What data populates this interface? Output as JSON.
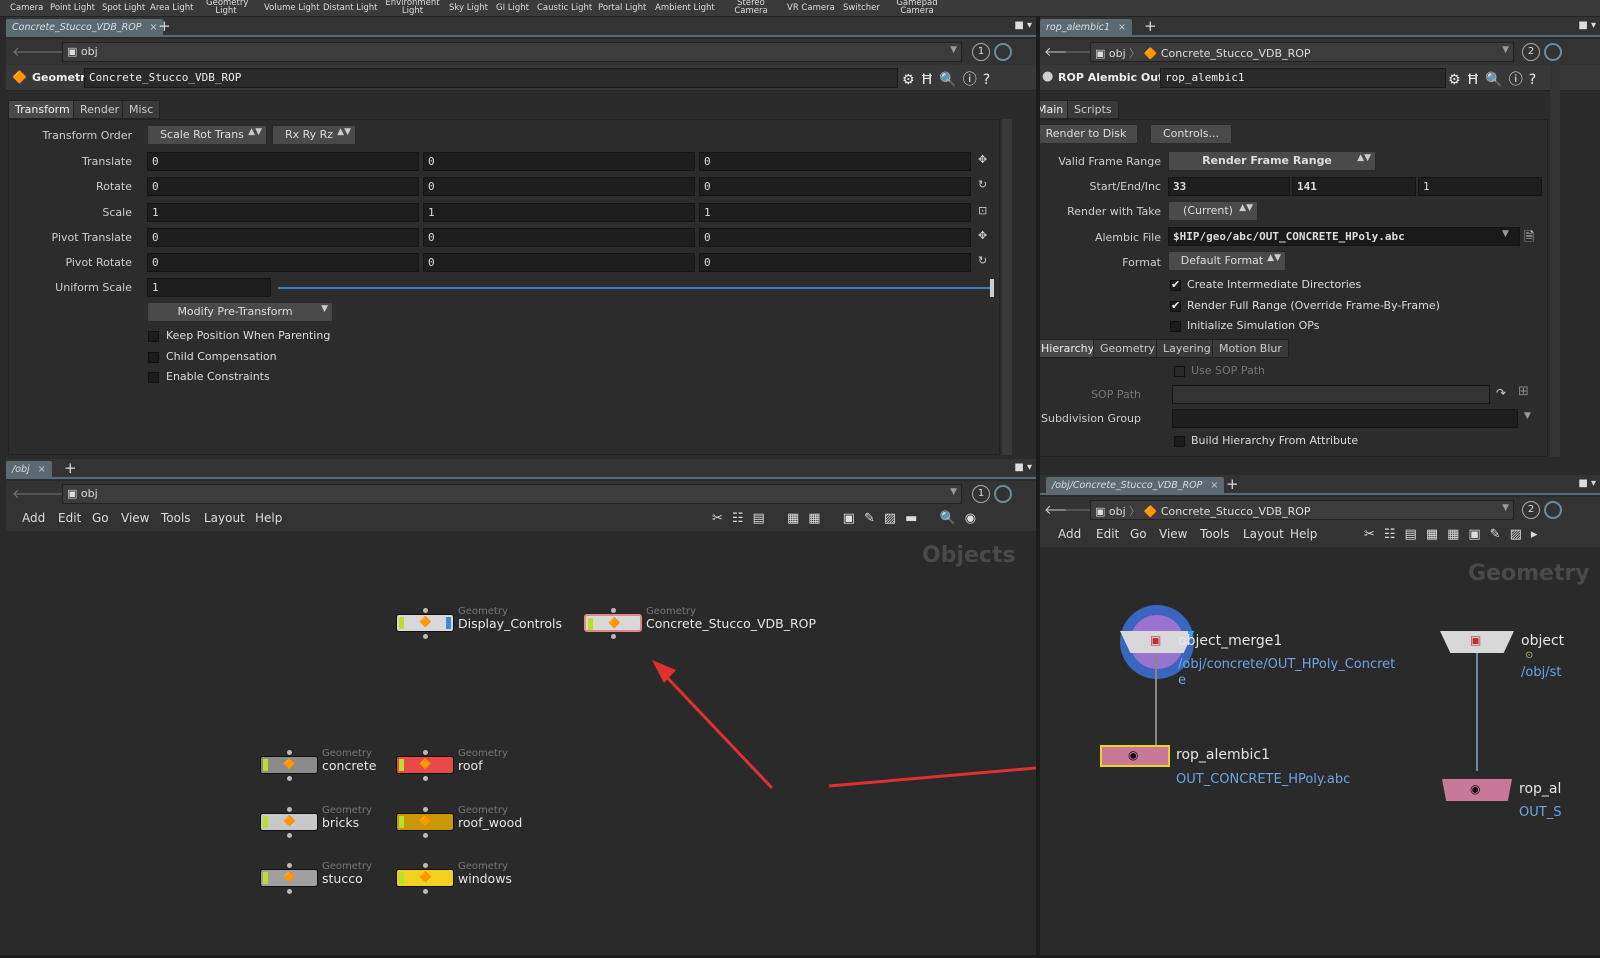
{
  "shelf": [
    "Camera",
    "Point Light",
    "Spot Light",
    "Area Light",
    "Geometry Light",
    "Volume Light",
    "Distant Light",
    "Environment Light",
    "Sky Light",
    "GI Light",
    "Caustic Light",
    "Portal Light",
    "Ambient Light",
    "Stereo Camera",
    "VR Camera",
    "Switcher",
    "Gamepad Camera"
  ],
  "tl": {
    "tab": "Concrete_Stucco_VDB_ROP",
    "path": "obj",
    "num": "1",
    "type": "Geometry",
    "name": "Concrete_Stucco_VDB_ROP",
    "tabs": [
      "Transform",
      "Render",
      "Misc"
    ],
    "transform_order_label": "Transform Order",
    "order1": "Scale Rot Trans",
    "order2": "Rx Ry Rz",
    "rows": [
      {
        "label": "Translate",
        "v": [
          "0",
          "0",
          "0"
        ]
      },
      {
        "label": "Rotate",
        "v": [
          "0",
          "0",
          "0"
        ]
      },
      {
        "label": "Scale",
        "v": [
          "1",
          "1",
          "1"
        ]
      },
      {
        "label": "Pivot Translate",
        "v": [
          "0",
          "0",
          "0"
        ]
      },
      {
        "label": "Pivot Rotate",
        "v": [
          "0",
          "0",
          "0"
        ]
      }
    ],
    "uniform_label": "Uniform Scale",
    "uniform": "1",
    "uniform_fraction": 1.0,
    "modify": "Modify Pre-Transform",
    "checks": [
      "Keep Position When Parenting",
      "Child Compensation",
      "Enable Constraints"
    ]
  },
  "tr": {
    "tab": "rop_alembic1",
    "path1": "obj",
    "path2": "Concrete_Stucco_VDB_ROP",
    "num": "2",
    "type": "ROP Alembic Output",
    "name": "rop_alembic1",
    "tabs": [
      "Main",
      "Scripts"
    ],
    "render_btn": "Render to Disk",
    "controls_btn": "Controls...",
    "vfr_label": "Valid Frame Range",
    "vfr": "Render Frame Range",
    "sei_label": "Start/End/Inc",
    "start": "33",
    "end": "141",
    "inc": "1",
    "take_label": "Render with Take",
    "take": "(Current)",
    "file_label": "Alembic File",
    "file": "$HIP/geo/abc/OUT_CONCRETE_HPoly.abc",
    "format_label": "Format",
    "format": "Default Format",
    "checks": [
      {
        "label": "Create Intermediate Directories",
        "on": true
      },
      {
        "label": "Render Full Range (Override Frame-By-Frame)",
        "on": true
      },
      {
        "label": "Initialize Simulation OPs",
        "on": false
      }
    ],
    "subtabs": [
      "Hierarchy",
      "Geometry",
      "Layering",
      "Motion Blur"
    ],
    "use_sop": "Use SOP Path",
    "sop_label": "SOP Path",
    "subdiv_label": "Subdivision Group",
    "build_label": "Build Hierarchy From Attribute"
  },
  "bl": {
    "tab": "/obj",
    "path": "obj",
    "num": "1",
    "menu": [
      "Add",
      "Edit",
      "Go",
      "View",
      "Tools",
      "Layout",
      "Help"
    ],
    "context": "Objects",
    "nodes": [
      {
        "sub": "Geometry",
        "name": "Display_Controls",
        "color": "#d8d8d8",
        "badge": "#3a8ad8"
      },
      {
        "sub": "Geometry",
        "name": "Concrete_Stucco_VDB_ROP",
        "color": "#d8d8d8",
        "badge": "#d8d8d8"
      },
      {
        "sub": "Geometry",
        "name": "concrete",
        "color": "#8a8a8a",
        "badge": "#8a8a8a"
      },
      {
        "sub": "Geometry",
        "name": "roof",
        "color": "#e84848",
        "badge": "#e84848"
      },
      {
        "sub": "Geometry",
        "name": "bricks",
        "color": "#c8c8c8",
        "badge": "#c8c8c8"
      },
      {
        "sub": "Geometry",
        "name": "roof_wood",
        "color": "#c8980a",
        "badge": "#c8980a"
      },
      {
        "sub": "Geometry",
        "name": "stucco",
        "color": "#a0a0a0",
        "badge": "#a0a0a0"
      },
      {
        "sub": "Geometry",
        "name": "windows",
        "color": "#f0d020",
        "badge": "#f0d020"
      }
    ]
  },
  "br": {
    "tab": "/obj/Concrete_Stucco_VDB_ROP",
    "path1": "obj",
    "path2": "Concrete_Stucco_VDB_ROP",
    "num": "2",
    "menu": [
      "Add",
      "Edit",
      "Go",
      "View",
      "Tools",
      "Layout",
      "Help"
    ],
    "context": "Geometry",
    "merge_name": "object_merge1",
    "merge_path1": "/obj/concrete/OUT_HPoly_Concret",
    "merge_path2": "e",
    "rop_name": "rop_alembic1",
    "rop_file": "OUT_CONCRETE_HPoly.abc",
    "merge2_name": "object",
    "merge2_path": "/obj/st",
    "rop2_name": "rop_al",
    "rop2_file": "OUT_S"
  },
  "colors": {
    "arrow": "#e03030",
    "rop": "#c87898"
  }
}
